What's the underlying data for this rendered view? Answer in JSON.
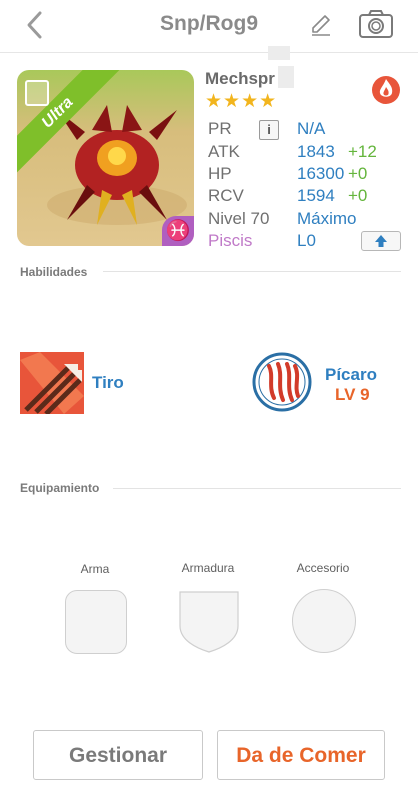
{
  "header": {
    "title": "Snp/Rog9",
    "back_icon": "chevron-left-icon",
    "edit_icon": "pencil-icon",
    "camera_icon": "camera-icon"
  },
  "monster": {
    "name": "Mechspr",
    "rarity_label": "Ultra",
    "stars": "★★★★",
    "attribute_icon": "fire-icon",
    "stats": {
      "pr": {
        "label": "PR",
        "value": "N/A"
      },
      "atk": {
        "label": "ATK",
        "value": "1843",
        "plus": "+12"
      },
      "hp": {
        "label": "HP",
        "value": "16300",
        "plus": "+0"
      },
      "rcv": {
        "label": "RCV",
        "value": "1594",
        "plus": "+0"
      },
      "level": {
        "label": "Nivel 70",
        "value": "Máximo"
      },
      "zodiac": {
        "label": "Piscis",
        "value": "L0"
      }
    },
    "info_button": "i",
    "zodiac_symbol": "♓"
  },
  "skills": {
    "section_title": "Habilidades",
    "active": {
      "name": "Tiro"
    },
    "leader": {
      "name": "Pícaro",
      "level": "LV 9"
    }
  },
  "equipment": {
    "section_title": "Equipamiento",
    "slots": [
      {
        "label": "Arma"
      },
      {
        "label": "Armadura"
      },
      {
        "label": "Accesorio"
      }
    ]
  },
  "actions": {
    "manage": "Gestionar",
    "feed": "Da de Comer"
  },
  "colors": {
    "blue": "#2f7fc0",
    "green": "#64b53c",
    "orange": "#e8652a",
    "purple": "#c07ac8"
  }
}
